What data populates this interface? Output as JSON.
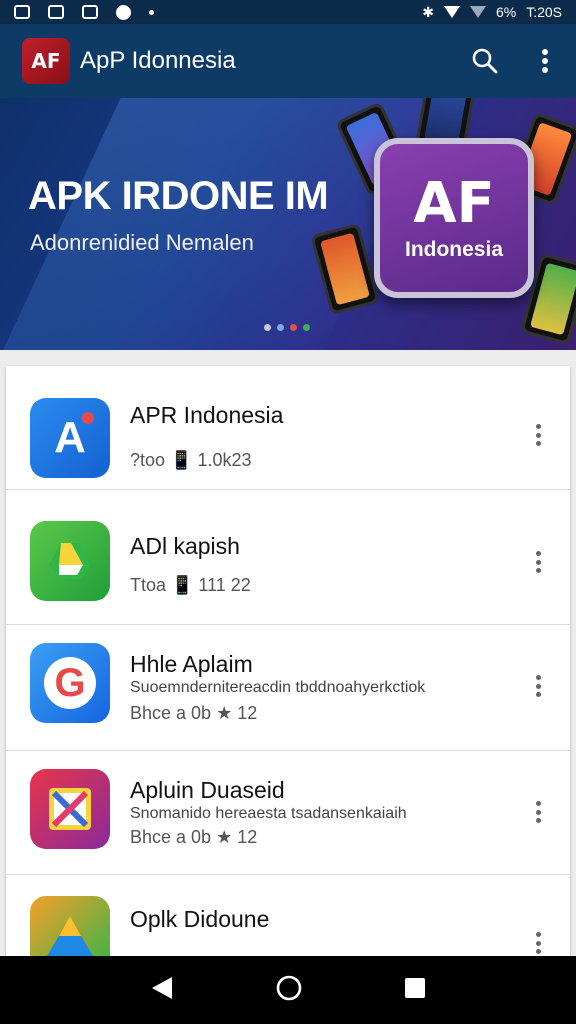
{
  "status_bar": {
    "battery": "6%",
    "time": "T:20S",
    "left_icons": [
      "image-icon",
      "doc-icon",
      "cast-icon",
      "sync-icon",
      "dot-icon"
    ],
    "right_icons": [
      "bluetooth-icon",
      "wifi-icon",
      "signal-icon"
    ]
  },
  "app_bar": {
    "logo": "AF",
    "title": "ApP Idonnesia",
    "actions": [
      "search-icon",
      "more-vert-icon"
    ]
  },
  "banner": {
    "title": "APK IRDONE IM",
    "subtitle": "Adonrenidied Nemalen",
    "badge_mark": "AF",
    "badge_text": "Indonesia",
    "dots": [
      "#c9c9d6",
      "#7fa9e0",
      "#e04f4f",
      "#3fb04f"
    ]
  },
  "apps": [
    {
      "title": "APR Indonesia",
      "desc": "",
      "meta": "?too 📱 1.0k23",
      "icon_letter": "A",
      "icon": "a-app-icon",
      "icon_color": "#1a73e8"
    },
    {
      "title": "ADl kapish",
      "desc": "",
      "meta": "Ttoa 📱 111 22",
      "icon_letter": "",
      "icon": "drive-app-icon",
      "icon_color": "#2fb54a"
    },
    {
      "title": "Hhle Aplaim",
      "desc": "Suoemndernitereacdin tbddnoahyerkctiok",
      "meta": "Bhce a 0b ★ 12",
      "icon_letter": "G",
      "icon": "g-app-icon",
      "icon_color": "#1e88e5"
    },
    {
      "title": "Apluin Duaseid",
      "desc": "Snomanido hereaesta tsadansenkaiaih",
      "meta": "Bhce a 0b ★ 12",
      "icon_letter": "",
      "icon": "x-app-icon",
      "icon_color": "#c2185b"
    },
    {
      "title": "Oplk Didoune",
      "desc": "",
      "meta": "",
      "icon_letter": "",
      "icon": "triangle-app-icon",
      "icon_color": "#ef6c00"
    }
  ],
  "nav_bar": {
    "buttons": [
      "back-icon",
      "home-icon",
      "recents-icon"
    ]
  }
}
